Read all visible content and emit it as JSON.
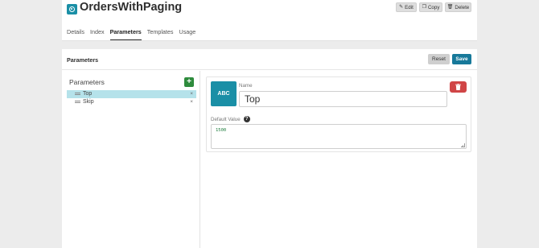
{
  "header": {
    "title": "OrdersWithPaging",
    "icon": "app-logo-icon",
    "actions": {
      "edit_label": "Edit",
      "copy_label": "Copy",
      "delete_label": "Delete"
    },
    "tabs": [
      {
        "label": "Details",
        "active": false
      },
      {
        "label": "Index",
        "active": false
      },
      {
        "label": "Parameters",
        "active": true
      },
      {
        "label": "Templates",
        "active": false
      },
      {
        "label": "Usage",
        "active": false
      }
    ]
  },
  "main": {
    "title": "Parameters",
    "reset_label": "Reset",
    "save_label": "Save",
    "left": {
      "heading": "Parameters",
      "add_label": "+",
      "items": [
        {
          "label": "Top",
          "selected": true,
          "remove": "×"
        },
        {
          "label": "Skip",
          "selected": false,
          "remove": "×"
        }
      ]
    },
    "detail": {
      "type_label": "ABC",
      "name_label": "Name",
      "name_value": "Top",
      "default_label": "Default Value",
      "help_glyph": "?",
      "default_value": "1500"
    }
  },
  "colors": {
    "accent": "#1a8fa6",
    "save": "#17799a",
    "add": "#2e8b3c",
    "danger": "#d04546",
    "selected_row": "#b5e2ea"
  }
}
